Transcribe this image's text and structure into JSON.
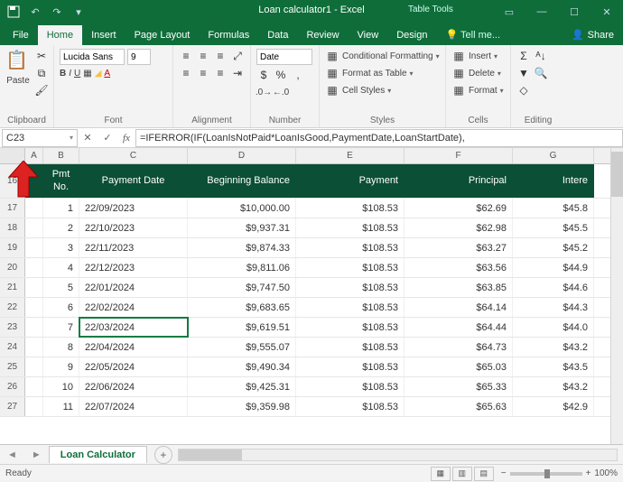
{
  "title": "Loan calculator1 - Excel",
  "table_tools": "Table Tools",
  "tabs": {
    "file": "File",
    "home": "Home",
    "insert": "Insert",
    "page_layout": "Page Layout",
    "formulas": "Formulas",
    "data": "Data",
    "review": "Review",
    "view": "View",
    "design": "Design",
    "tell": "Tell me...",
    "share": "Share"
  },
  "ribbon": {
    "clipboard": {
      "paste": "Paste",
      "label": "Clipboard"
    },
    "font": {
      "name": "Lucida Sans",
      "size": "9",
      "label": "Font"
    },
    "alignment": {
      "label": "Alignment"
    },
    "number": {
      "format": "Date",
      "label": "Number"
    },
    "styles": {
      "cond": "Conditional Formatting",
      "table": "Format as Table",
      "cell": "Cell Styles",
      "label": "Styles"
    },
    "cells": {
      "insert": "Insert",
      "delete": "Delete",
      "format": "Format",
      "label": "Cells"
    },
    "editing": {
      "label": "Editing"
    }
  },
  "namebox": "C23",
  "formula": "=IFERROR(IF(LoanIsNotPaid*LoanIsGood,PaymentDate,LoanStartDate),",
  "columns": [
    "A",
    "B",
    "C",
    "D",
    "E",
    "F",
    "G"
  ],
  "header_row": "16",
  "headers": {
    "pmt": "Pmt No.",
    "date": "Payment Date",
    "begin": "Beginning Balance",
    "payment": "Payment",
    "principal": "Principal",
    "interest": "Intere"
  },
  "rows": [
    {
      "rh": "17",
      "no": "1",
      "date": "22/09/2023",
      "begin": "$10,000.00",
      "pay": "$108.53",
      "prin": "$62.69",
      "int": "$45.8"
    },
    {
      "rh": "18",
      "no": "2",
      "date": "22/10/2023",
      "begin": "$9,937.31",
      "pay": "$108.53",
      "prin": "$62.98",
      "int": "$45.5"
    },
    {
      "rh": "19",
      "no": "3",
      "date": "22/11/2023",
      "begin": "$9,874.33",
      "pay": "$108.53",
      "prin": "$63.27",
      "int": "$45.2"
    },
    {
      "rh": "20",
      "no": "4",
      "date": "22/12/2023",
      "begin": "$9,811.06",
      "pay": "$108.53",
      "prin": "$63.56",
      "int": "$44.9"
    },
    {
      "rh": "21",
      "no": "5",
      "date": "22/01/2024",
      "begin": "$9,747.50",
      "pay": "$108.53",
      "prin": "$63.85",
      "int": "$44.6"
    },
    {
      "rh": "22",
      "no": "6",
      "date": "22/02/2024",
      "begin": "$9,683.65",
      "pay": "$108.53",
      "prin": "$64.14",
      "int": "$44.3"
    },
    {
      "rh": "23",
      "no": "7",
      "date": "22/03/2024",
      "begin": "$9,619.51",
      "pay": "$108.53",
      "prin": "$64.44",
      "int": "$44.0"
    },
    {
      "rh": "24",
      "no": "8",
      "date": "22/04/2024",
      "begin": "$9,555.07",
      "pay": "$108.53",
      "prin": "$64.73",
      "int": "$43.2"
    },
    {
      "rh": "25",
      "no": "9",
      "date": "22/05/2024",
      "begin": "$9,490.34",
      "pay": "$108.53",
      "prin": "$65.03",
      "int": "$43.5"
    },
    {
      "rh": "26",
      "no": "10",
      "date": "22/06/2024",
      "begin": "$9,425.31",
      "pay": "$108.53",
      "prin": "$65.33",
      "int": "$43.2"
    },
    {
      "rh": "27",
      "no": "11",
      "date": "22/07/2024",
      "begin": "$9,359.98",
      "pay": "$108.53",
      "prin": "$65.63",
      "int": "$42.9"
    }
  ],
  "selected_row": "23",
  "sheet_tab": "Loan Calculator",
  "status": {
    "ready": "Ready",
    "zoom": "100%"
  }
}
